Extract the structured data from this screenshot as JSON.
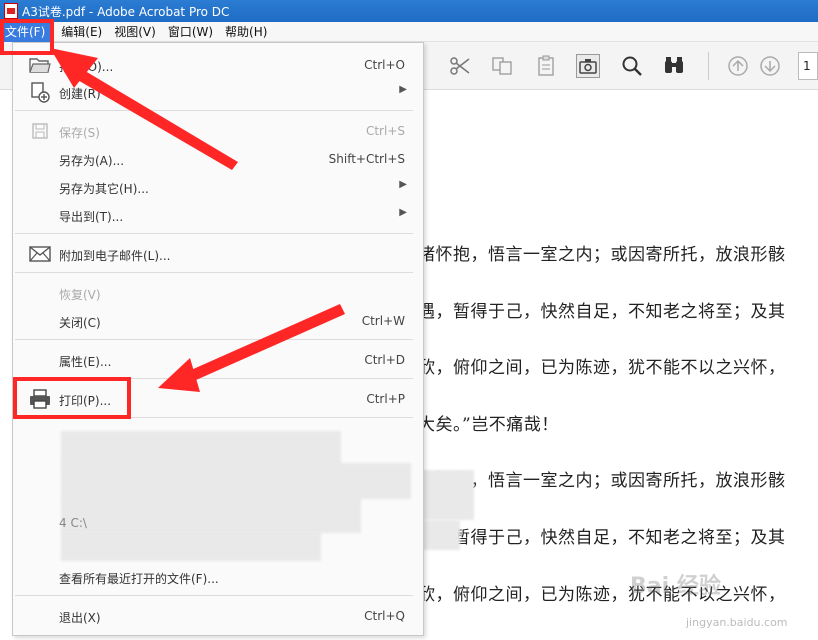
{
  "window": {
    "title": "A3试卷.pdf - Adobe Acrobat Pro DC"
  },
  "menubar": [
    {
      "label": "文件(F)",
      "active": true
    },
    {
      "label": "编辑(E)"
    },
    {
      "label": "视图(V)"
    },
    {
      "label": "窗口(W)"
    },
    {
      "label": "帮助(H)"
    }
  ],
  "toolbar": {
    "page_number": "1"
  },
  "file_menu": {
    "items": [
      {
        "label": "打开(O)...",
        "shortcut": "Ctrl+O",
        "icon": "folder-open-icon"
      },
      {
        "label": "创建(R)",
        "submenu": true,
        "icon": "create-pdf-icon"
      },
      {
        "label": "保存(S)",
        "shortcut": "Ctrl+S",
        "disabled": true,
        "icon": "save-icon"
      },
      {
        "label": "另存为(A)...",
        "shortcut": "Shift+Ctrl+S"
      },
      {
        "label": "另存为其它(H)...",
        "submenu": true
      },
      {
        "label": "导出到(T)...",
        "submenu": true
      },
      {
        "label": "附加到电子邮件(L)...",
        "icon": "mail-icon"
      },
      {
        "label": "恢复(V)",
        "disabled": true
      },
      {
        "label": "关闭(C)",
        "shortcut": "Ctrl+W"
      },
      {
        "label": "属性(E)...",
        "shortcut": "Ctrl+D"
      },
      {
        "label": "打印(P)...",
        "shortcut": "Ctrl+P",
        "icon": "printer-icon"
      },
      {
        "label": "4 C:\\"
      },
      {
        "label": "查看所有最近打开的文件(F)..."
      },
      {
        "label": "退出(X)",
        "shortcut": "Ctrl+Q"
      }
    ]
  },
  "document": {
    "lines": [
      "诸怀抱，悟言一室之内；或因寄所托，放浪形骸",
      "遇，暂得于己，快然自足，不知老之将至；及其",
      "欣，俯仰之间，已为陈迹，犹不能不以之兴怀，",
      "大矣。”岂不痛哉！",
      "诸怀抱，悟言一室之内；或因寄所托，放浪形骸",
      "遇，暂得于己，快然自足，不知老之将至；及其",
      "欣，俯仰之间，已为陈迹，犹不能不以之兴怀，"
    ]
  },
  "colors": {
    "highlight": "#ff2626",
    "menu_active": "#3a7be0",
    "titlebar": "#1f6cc4"
  },
  "watermark": {
    "brand": "Bai 经验",
    "url": "jingyan.baidu.com"
  }
}
